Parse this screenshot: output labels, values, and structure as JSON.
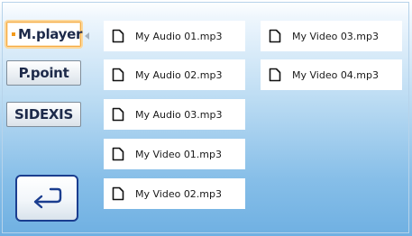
{
  "mode_buttons": [
    {
      "label": "M.player",
      "active": true
    },
    {
      "label": "P.point",
      "active": false
    },
    {
      "label": "SIDEXIS",
      "active": false
    }
  ],
  "back_button": {
    "icon": "return-arrow-icon"
  },
  "files": [
    {
      "name": "My Audio 01.mp3",
      "icon": "file-icon"
    },
    {
      "name": "My Audio 02.mp3",
      "icon": "file-icon"
    },
    {
      "name": "My Audio 03.mp3",
      "icon": "file-icon"
    },
    {
      "name": "My Video 01.mp3",
      "icon": "file-icon"
    },
    {
      "name": "My Video 02.mp3",
      "icon": "file-icon"
    },
    {
      "name": "My Video 03.mp3",
      "icon": "file-icon"
    },
    {
      "name": "My Video 04.mp3",
      "icon": "file-icon"
    }
  ],
  "colors": {
    "active_border": "#f6ab44",
    "back_border": "#1a3d8f",
    "background_top": "#ffffff",
    "background_bottom": "#6fb0e2"
  }
}
